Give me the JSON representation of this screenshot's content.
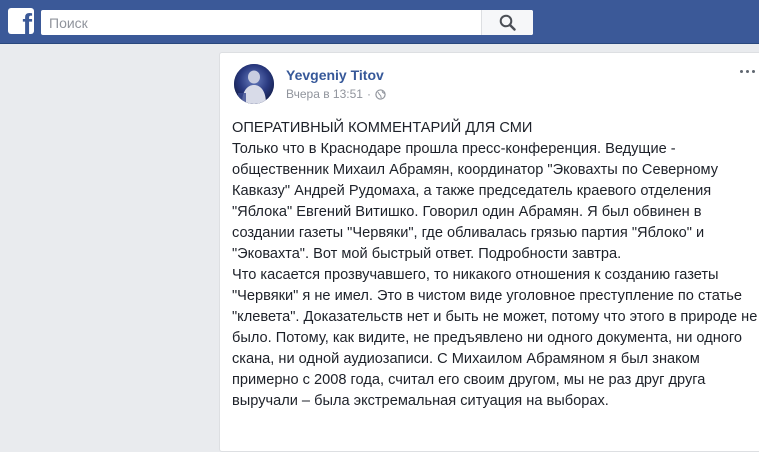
{
  "topbar": {
    "logo_letter": "f",
    "search_placeholder": "Поиск",
    "brand_color": "#3b5998"
  },
  "post": {
    "author": "Yevgeniy Titov",
    "time": "Вчера в 13:51",
    "separator": "·",
    "privacy_icon": "globe-icon",
    "paragraphs": [
      "ОПЕРАТИВНЫЙ КОММЕНТАРИЙ ДЛЯ СМИ",
      "Только что в Краснодаре прошла пресс-конференция. Ведущие - общественник Михаил Абрамян, координатор \"Эковахты по Северному Кавказу\" Андрей Рудомаха, а также председатель краевого отделения \"Яблока\" Евгений Витишко. Говорил один Абрамян. Я был обвинен в создании газеты \"Червяки\", где обливалась грязью партия \"Яблоко\" и \"Эковахта\". Вот мой быстрый ответ. Подробности завтра.",
      "Что касается прозвучавшего, то никакого отношения к созданию газеты \"Червяки\" я не имел. Это в чистом виде уголовное преступление по статье \"клевета\". Доказательств нет и быть не может, потому что этого в природе не было. Потому, как видите, не предъявлено ни одного документа, ни одного скана, ни одной аудиозаписи. С Михаилом Абрамяном я был знаком примерно с 2008 года, считал его своим другом, мы не раз друг друга выручали – была экстремальная ситуация на выборах."
    ]
  }
}
